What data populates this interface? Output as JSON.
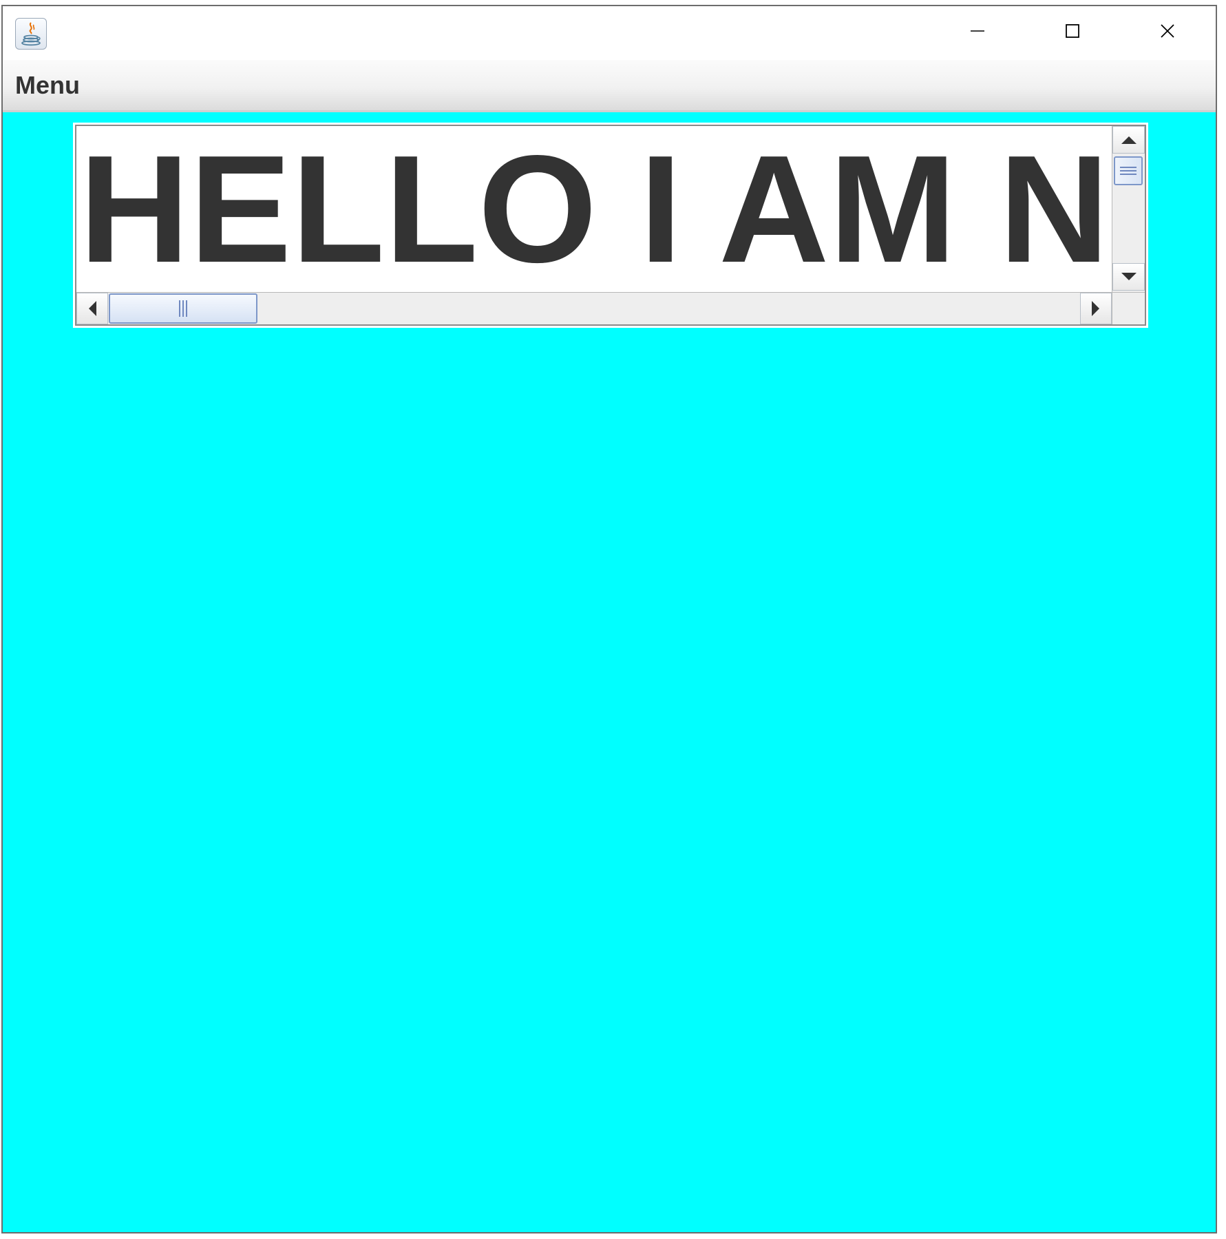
{
  "window": {
    "title": "",
    "icon": "java-coffee-icon",
    "controls": {
      "minimize": "minimize-icon",
      "maximize": "maximize-icon",
      "close": "close-icon"
    }
  },
  "menubar": {
    "items": [
      {
        "label": "Menu"
      }
    ]
  },
  "content": {
    "background_color": "#00ffff",
    "text_area": {
      "text": "HELLO I AM NI",
      "text_color": "#333333",
      "horizontal_scroll_position": 0.0,
      "vertical_scroll_position": 0.0
    }
  },
  "colors": {
    "accent": "#7d97c9",
    "window_border": "#6d6d6d"
  }
}
